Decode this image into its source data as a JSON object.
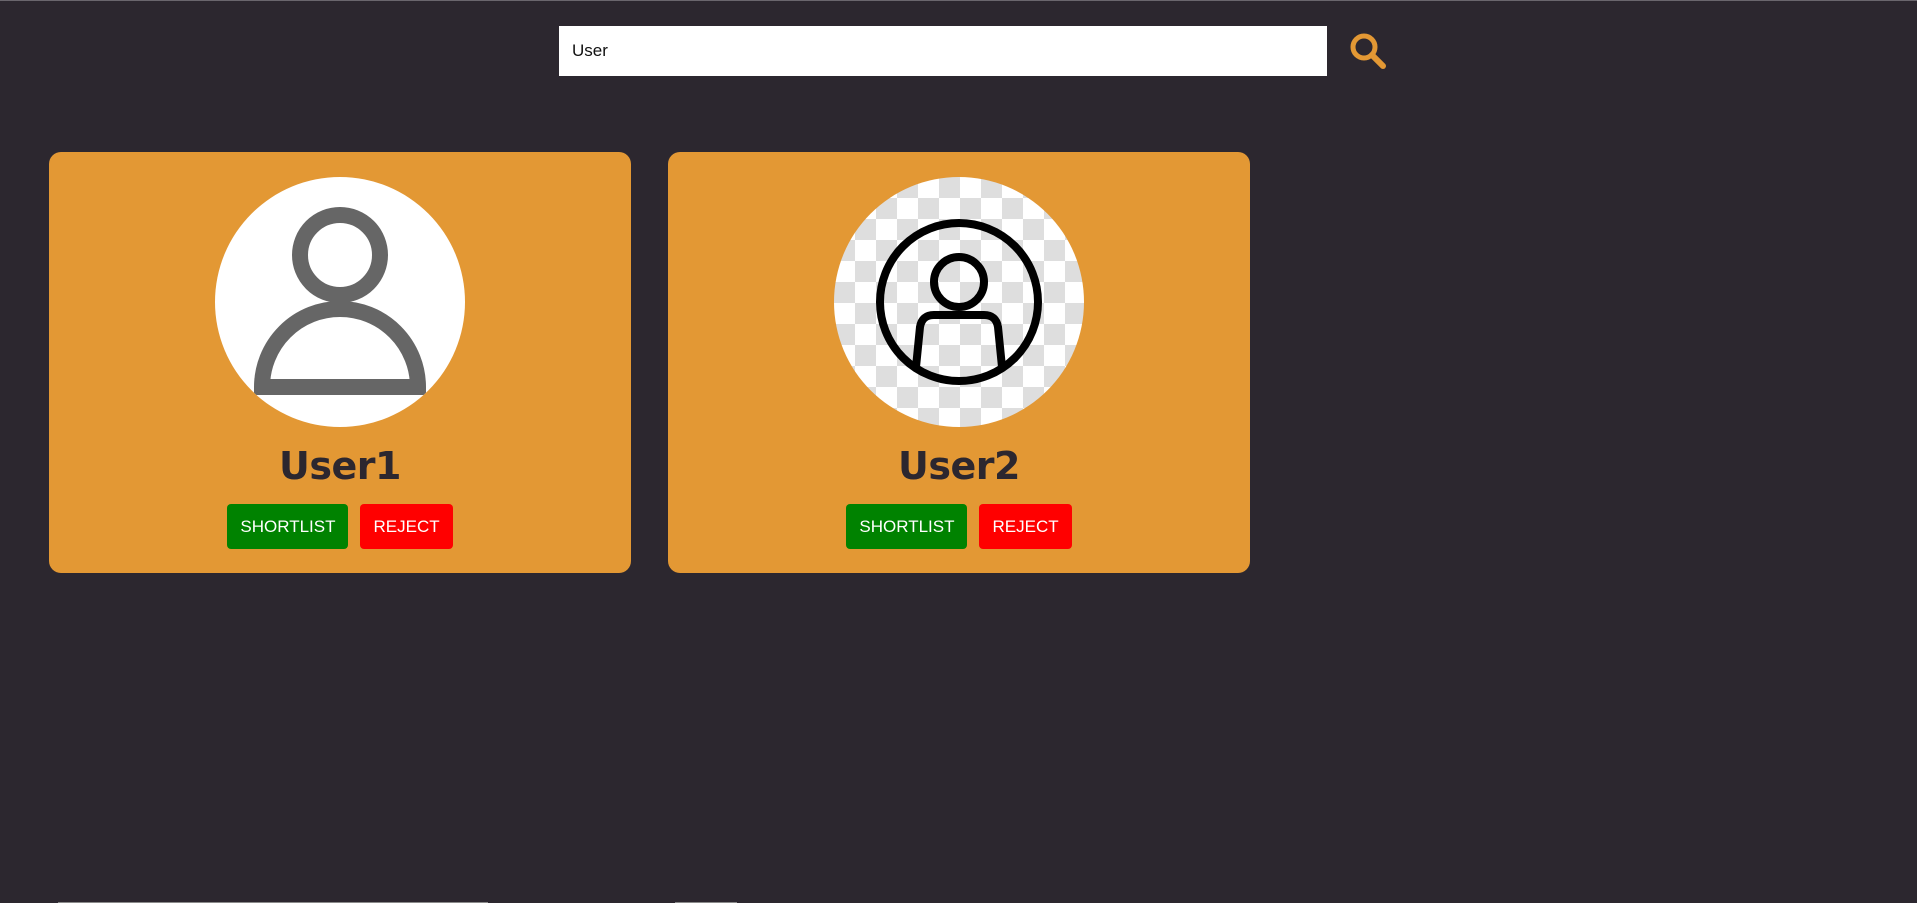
{
  "search": {
    "value": "User",
    "icon": "search-icon",
    "accent_color": "#e39834"
  },
  "candidates": [
    {
      "name": "User1",
      "avatar_icon": "user-outline-icon",
      "shortlist_label": "SHORTLIST",
      "reject_label": "REJECT"
    },
    {
      "name": "User2",
      "avatar_icon": "user-circle-icon",
      "shortlist_label": "SHORTLIST",
      "reject_label": "REJECT"
    }
  ],
  "colors": {
    "background": "#2c272f",
    "card": "#e39834",
    "shortlist": "#008200",
    "reject": "#ff0000"
  }
}
